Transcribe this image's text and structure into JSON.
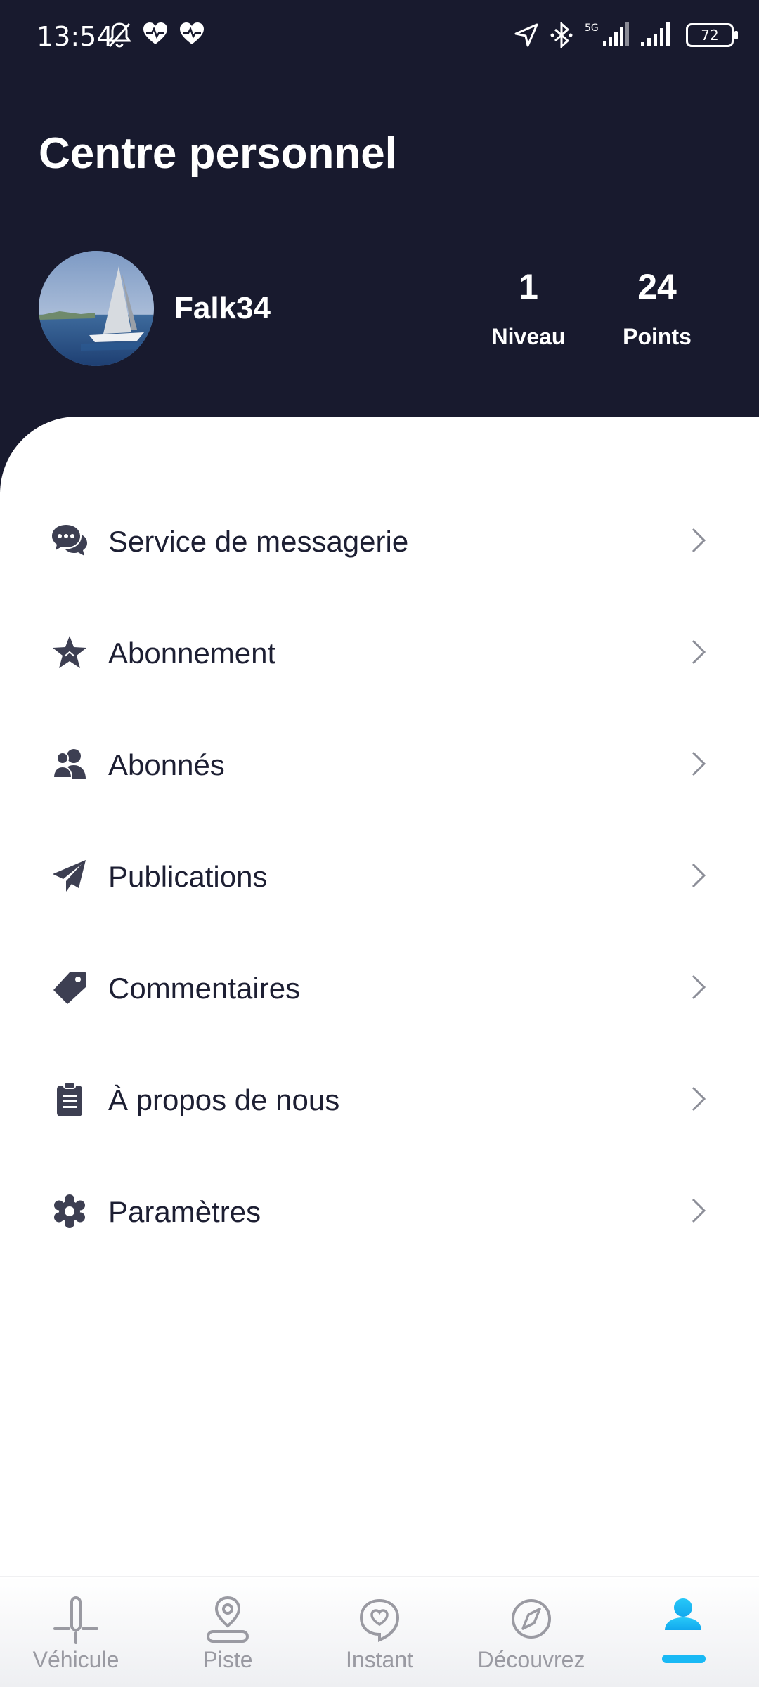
{
  "status_bar": {
    "time": "13:54",
    "network": "5G",
    "battery": "72"
  },
  "header": {
    "title": "Centre personnel"
  },
  "profile": {
    "username": "Falk34",
    "stats": [
      {
        "value": "1",
        "label": "Niveau"
      },
      {
        "value": "24",
        "label": "Points"
      }
    ]
  },
  "menu": {
    "items": [
      {
        "label": "Service de messagerie",
        "icon": "chat-bubbles-icon"
      },
      {
        "label": "Abonnement",
        "icon": "star-icon"
      },
      {
        "label": "Abonnés",
        "icon": "users-icon"
      },
      {
        "label": "Publications",
        "icon": "paper-plane-icon"
      },
      {
        "label": "Commentaires",
        "icon": "tag-icon"
      },
      {
        "label": "À propos de nous",
        "icon": "clipboard-icon"
      },
      {
        "label": "Paramètres",
        "icon": "gear-icon"
      }
    ]
  },
  "bottom_nav": {
    "items": [
      {
        "label": "Véhicule",
        "icon": "vehicle-icon",
        "active": false
      },
      {
        "label": "Piste",
        "icon": "location-pin-icon",
        "active": false
      },
      {
        "label": "Instant",
        "icon": "heart-bubble-icon",
        "active": false
      },
      {
        "label": "Découvrez",
        "icon": "compass-icon",
        "active": false
      },
      {
        "label": "",
        "icon": "user-icon",
        "active": true
      }
    ]
  },
  "colors": {
    "header_bg": "#181a2e",
    "accent": "#19b9f5",
    "icon_dark": "#3d3f52",
    "inactive_nav": "#9a9aa2"
  }
}
